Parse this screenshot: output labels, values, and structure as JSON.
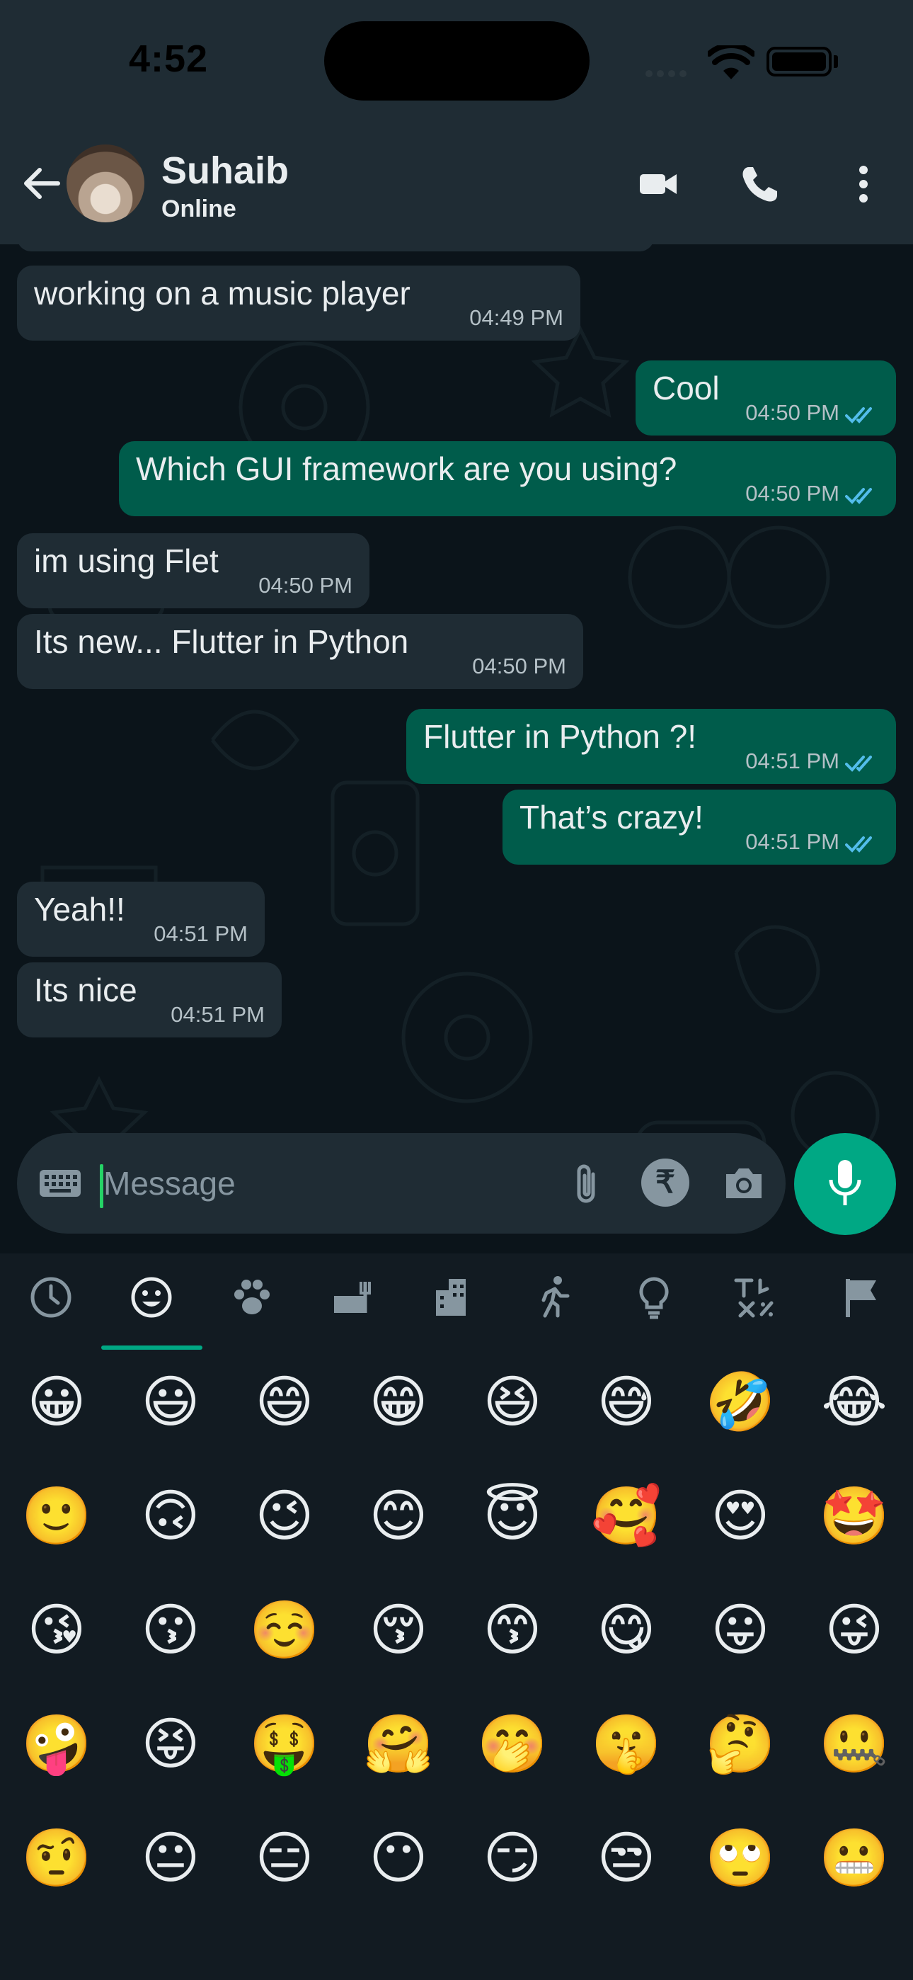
{
  "status_bar": {
    "time": "4:52"
  },
  "header": {
    "name": "Suhaib",
    "status": "Online"
  },
  "messages": [
    {
      "dir": "in",
      "text": "working on a music player",
      "time": "04:49 PM"
    },
    {
      "dir": "out",
      "text": "Cool",
      "time": "04:50 PM"
    },
    {
      "dir": "out",
      "text": "Which GUI framework are you using?",
      "time": "04:50 PM"
    },
    {
      "dir": "in",
      "text": "im using Flet",
      "time": "04:50 PM"
    },
    {
      "dir": "in",
      "text": "Its new... Flutter in Python",
      "time": "04:50 PM"
    },
    {
      "dir": "out",
      "text": "Flutter in Python ?!",
      "time": "04:51 PM"
    },
    {
      "dir": "out",
      "text": "That’s crazy!",
      "time": "04:51 PM"
    },
    {
      "dir": "in",
      "text": "Yeah!!",
      "time": "04:51 PM"
    },
    {
      "dir": "in",
      "text": "Its nice",
      "time": "04:51 PM"
    }
  ],
  "composer": {
    "placeholder": "Message",
    "currency_symbol": "₹"
  },
  "emoji_categories": [
    "recent",
    "smileys",
    "animals",
    "food",
    "travel",
    "activity",
    "objects",
    "symbols",
    "flags"
  ],
  "emoji_selected_category": "smileys",
  "emojis": [
    "😀",
    "😃",
    "😄",
    "😁",
    "😆",
    "😅",
    "🤣",
    "😂",
    "🙂",
    "🙃",
    "😉",
    "😊",
    "😇",
    "🥰",
    "😍",
    "🤩",
    "😘",
    "😗",
    "☺️",
    "😚",
    "😙",
    "😋",
    "😛",
    "😜",
    "🤪",
    "😝",
    "🤑",
    "🤗",
    "🤭",
    "🤫",
    "🤔",
    "🤐",
    "🤨",
    "😐",
    "😑",
    "😶",
    "😏",
    "😒",
    "🙄",
    "😬"
  ],
  "colors": {
    "incoming": "#1f2c34",
    "outgoing": "#005c4b",
    "accent": "#00a884",
    "read_ticks": "#53bdeb"
  }
}
